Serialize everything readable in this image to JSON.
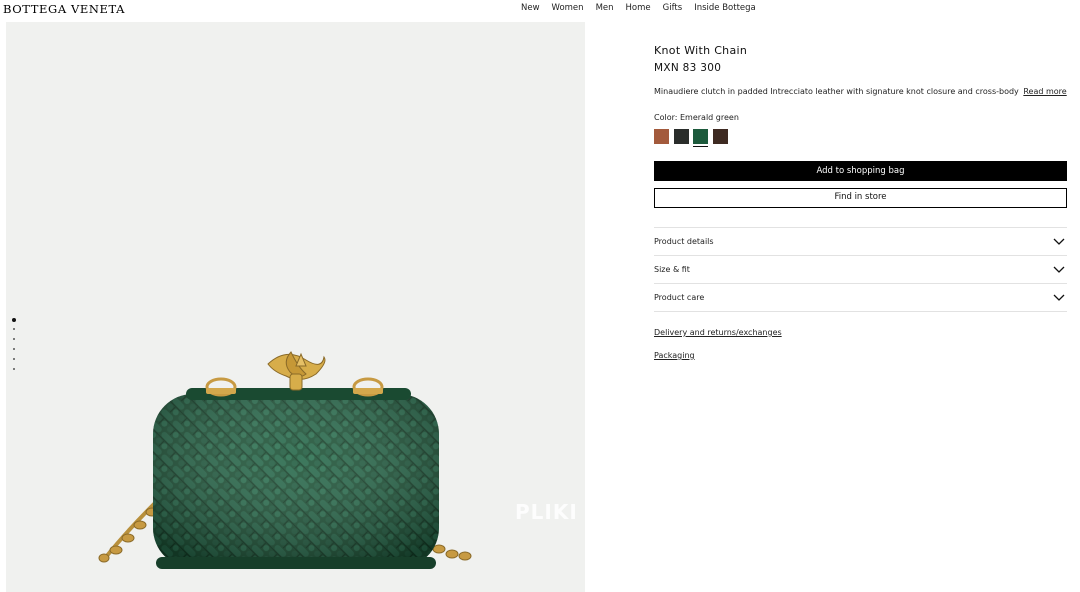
{
  "header": {
    "logo": "BOTTEGA VENETA",
    "nav": [
      "New",
      "Women",
      "Men",
      "Home",
      "Gifts",
      "Inside Bottega"
    ]
  },
  "gallery": {
    "image_count": 6,
    "active_index": 0,
    "watermark": "PLIKI",
    "bag_color": "#1e5a3a"
  },
  "product": {
    "title": "Knot With Chain",
    "price": "MXN 83 300",
    "description": "Minaudiere clutch in padded Intrecciato leather with signature knot closure and cross-body",
    "read_more": "Read more",
    "color_label": "Color: Emerald green",
    "swatches": [
      {
        "name": "brown-swatch",
        "color": "#a35a3c"
      },
      {
        "name": "black-swatch",
        "color": "#2a2d2b"
      },
      {
        "name": "emerald-green-swatch",
        "color": "#1d5a3c",
        "selected": true
      },
      {
        "name": "dark-brown-swatch",
        "color": "#3e2a22"
      }
    ],
    "add_to_bag": "Add to shopping bag",
    "find_in_store": "Find in store",
    "accordion": [
      "Product details",
      "Size & fit",
      "Product care"
    ],
    "links": [
      "Delivery and returns/exchanges",
      "Packaging"
    ]
  }
}
